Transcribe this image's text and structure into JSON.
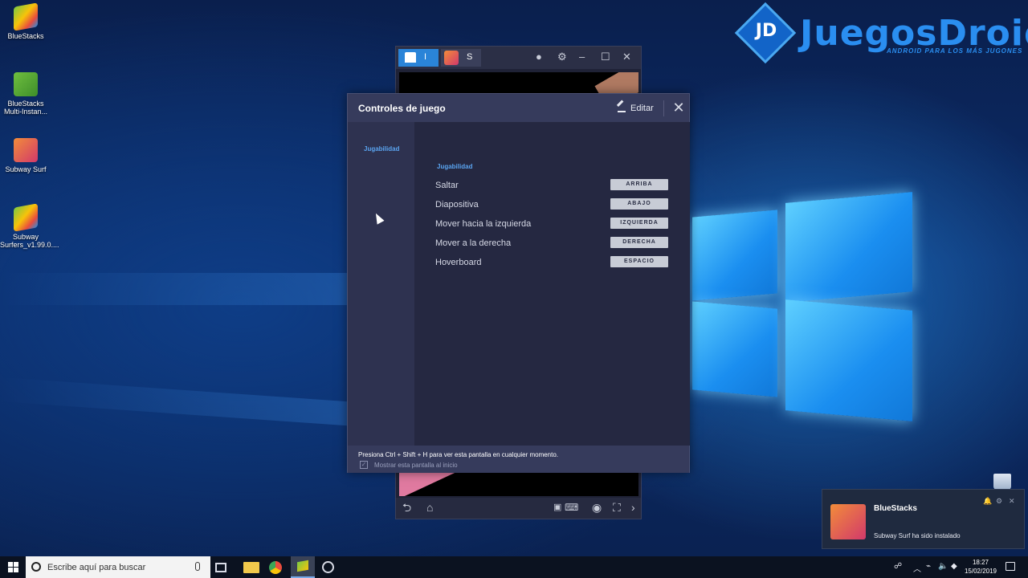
{
  "desktop": {
    "icons": [
      {
        "label": "BlueStacks",
        "icon": "bluestacks-icon"
      },
      {
        "label": "BlueStacks Multi-Instan...",
        "icon": "bluestacks-multi-icon"
      },
      {
        "label": "Subway Surf",
        "icon": "subway-surf-icon"
      },
      {
        "label": "Subway Surfers_v1.99.0....",
        "icon": "bluestacks-apk-icon"
      }
    ]
  },
  "watermark": {
    "badge": "JD",
    "brand": "JuegosDroid",
    "tagline": "ANDROID PARA LOS MÁS JUGONES",
    "color": "#2a8ef0"
  },
  "bluestacks_window": {
    "home_tab_label": "I",
    "game_tab_label": "S"
  },
  "dialog": {
    "title": "Controles de juego",
    "edit_label": "Editar",
    "sidebar_item": "Jugabilidad",
    "section_title": "Jugabilidad",
    "controls": [
      {
        "action": "Saltar",
        "key": "ARRIBA"
      },
      {
        "action": "Diapositiva",
        "key": "ABAJO"
      },
      {
        "action": "Mover hacia la izquierda",
        "key": "IZQUIERDA"
      },
      {
        "action": "Mover a la derecha",
        "key": "DERECHA"
      },
      {
        "action": "Hoverboard",
        "key": "ESPACIO"
      }
    ],
    "footer_hint": "Presiona Ctrl + Shift + H para ver esta pantalla en cualquier momento.",
    "show_on_start_label": "Mostrar esta pantalla al inicio",
    "show_on_start_checked": true,
    "accent_color": "#5aa4f0"
  },
  "notification": {
    "title": "BlueStacks",
    "message": "Subway Surf ha sido instalado"
  },
  "taskbar": {
    "search_placeholder": "Escribe aquí para buscar",
    "time": "18:27",
    "date": "15/02/2019"
  }
}
